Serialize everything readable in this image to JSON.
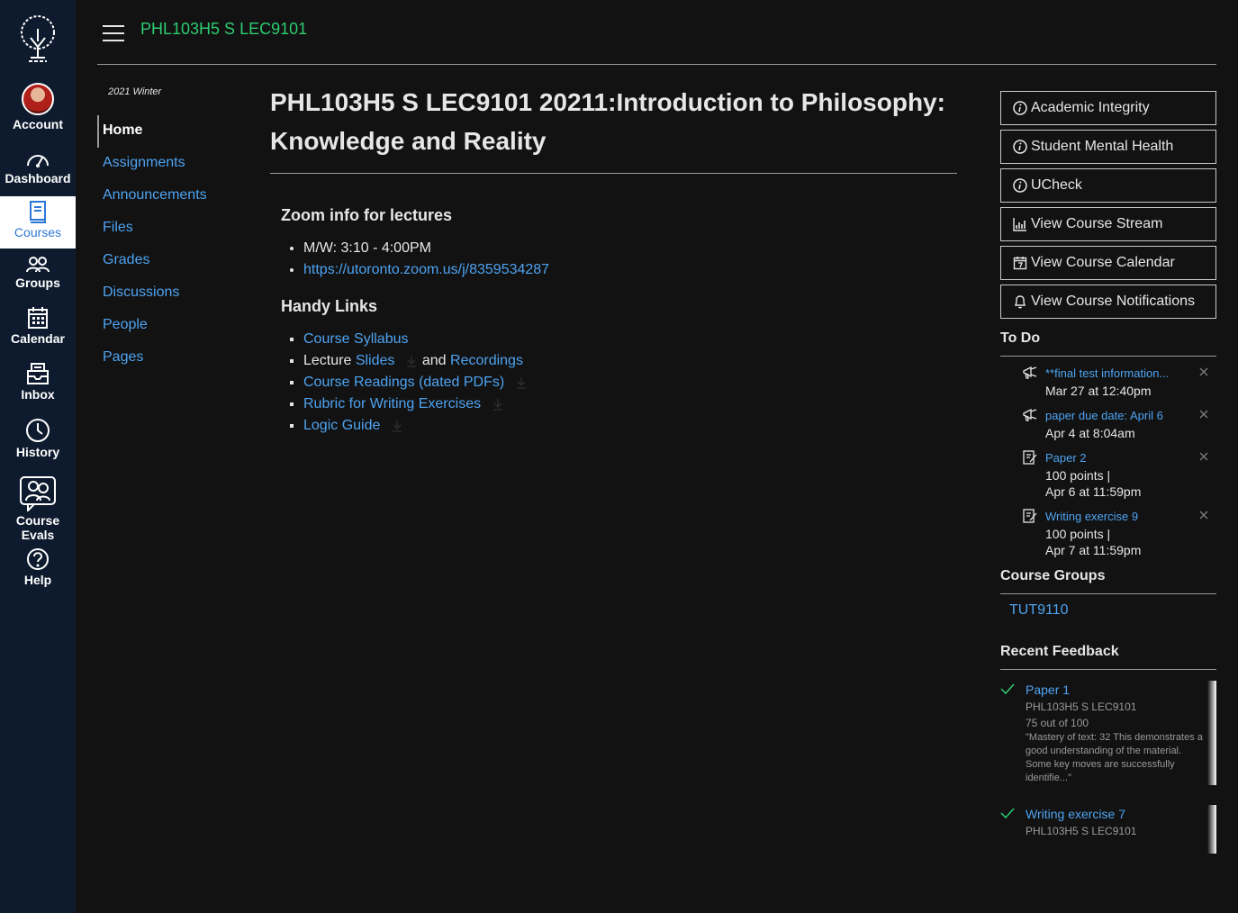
{
  "global_nav": {
    "items": [
      {
        "label": "Account",
        "icon": "avatar"
      },
      {
        "label": "Dashboard",
        "icon": "dashboard-icon"
      },
      {
        "label": "Courses",
        "icon": "courses-icon"
      },
      {
        "label": "Groups",
        "icon": "groups-icon"
      },
      {
        "label": "Calendar",
        "icon": "calendar-icon"
      },
      {
        "label": "Inbox",
        "icon": "inbox-icon"
      },
      {
        "label": "History",
        "icon": "history-icon"
      },
      {
        "label": "Course Evals",
        "icon": "course-evals-icon"
      },
      {
        "label": "Help",
        "icon": "help-icon"
      }
    ],
    "active": "Courses"
  },
  "header": {
    "breadcrumb": "PHL103H5 S LEC9101"
  },
  "course_nav": {
    "term": "2021 Winter",
    "items": [
      "Home",
      "Assignments",
      "Announcements",
      "Files",
      "Grades",
      "Discussions",
      "People",
      "Pages"
    ],
    "active": "Home"
  },
  "main": {
    "title": "PHL103H5 S LEC9101 20211:Introduction to Philosophy: Knowledge and Reality",
    "zoom_heading": "Zoom info for lectures",
    "zoom_time": "M/W: 3:10 - 4:00PM",
    "zoom_link": "https://utoronto.zoom.us/j/8359534287",
    "links_heading": "Handy Links",
    "syllabus": "Course Syllabus",
    "lecture_prefix": "Lecture",
    "slides": "Slides",
    "and": "and",
    "recordings": "Recordings",
    "readings": "Course Readings (dated PDFs)",
    "rubric": "Rubric for Writing Exercises",
    "logic": "Logic Guide"
  },
  "sidebar": {
    "buttons": [
      "Academic Integrity",
      "Student Mental Health",
      "UCheck",
      "View Course Stream",
      "View Course Calendar",
      "View Course Notifications"
    ],
    "todo_heading": "To Do",
    "todos": [
      {
        "title": "**final test information...",
        "meta1": "Mar 27 at 12:40pm",
        "meta2": "",
        "icon": "announcement-icon"
      },
      {
        "title": "paper due date: April 6",
        "meta1": "Apr 4 at 8:04am",
        "meta2": "",
        "icon": "announcement-icon"
      },
      {
        "title": "Paper 2",
        "meta1": "100 points  |",
        "meta2": "Apr 6 at 11:59pm",
        "icon": "assignment-icon"
      },
      {
        "title": "Writing exercise 9",
        "meta1": "100 points  |",
        "meta2": "Apr 7 at 11:59pm",
        "icon": "assignment-icon"
      }
    ],
    "groups_heading": "Course Groups",
    "group": "TUT9110",
    "feedback_heading": "Recent Feedback",
    "feedback": [
      {
        "title": "Paper 1",
        "course": "PHL103H5 S LEC9101",
        "score": "75 out of 100",
        "comment": "\"Mastery of text: 32 This demonstrates a good understanding of the material. Some key moves are successfully identifie...\""
      },
      {
        "title": "Writing exercise 7",
        "course": "PHL103H5 S LEC9101",
        "score": "",
        "comment": ""
      }
    ]
  },
  "colors": {
    "nav_bg": "#0e1b2e",
    "link": "#4ea3f1",
    "breadcrumb": "#2ecc71",
    "page_bg": "#121212",
    "check": "#2ecc71"
  }
}
